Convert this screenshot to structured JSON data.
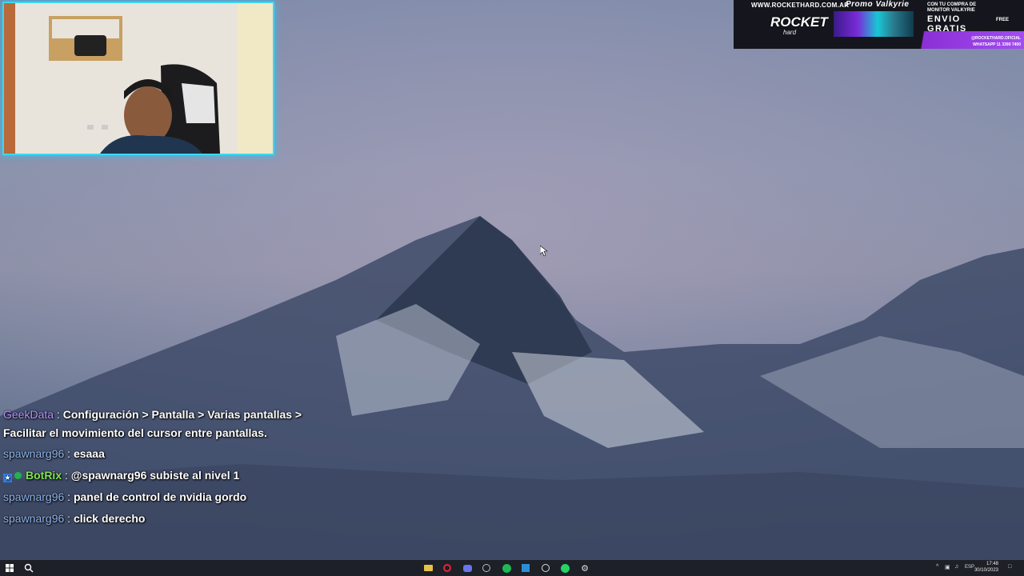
{
  "webcam": {
    "label": "streamer-webcam"
  },
  "ad": {
    "url": "WWW.ROCKETHARD.COM.AR",
    "promo_title": "Promo Valkyrie",
    "small_text": "CON TU COMPRA DE MONITOR VALKYRIE",
    "envio": "ENVIO",
    "gratis": "GRATIS",
    "logo": "ROCKET",
    "logo_sub": "hard",
    "free_badge": "FREE",
    "social_1": "@ROCKETHARD.OFICIAL",
    "social_2": "WHATSAPP 11 3390 7400"
  },
  "chat": {
    "messages": [
      {
        "user": "GeekData",
        "sep": " : ",
        "text": "Configuración > Pantalla > Varias pantallas >",
        "continuation": "Facilitar el movimiento del cursor entre pantallas."
      },
      {
        "user": "spawnarg96",
        "sep": " : ",
        "text": "esaaa"
      },
      {
        "user": "BotRix",
        "sep": " : ",
        "text": "@spawnarg96 subiste al nivel 1"
      },
      {
        "user": "spawnarg96",
        "sep": " : ",
        "text": "panel de control de nvidia gordo"
      },
      {
        "user": "spawnarg96",
        "sep": " : ",
        "text": "click derecho"
      }
    ]
  },
  "taskbar": {
    "lang": "ESP",
    "time": "17:48",
    "date": "30/10/2023",
    "apps": [
      "folder-icon",
      "opera-icon",
      "discord-icon",
      "chrome-icon",
      "spotify-icon",
      "editor-icon",
      "network-icon",
      "whatsapp-icon",
      "settings-icon"
    ]
  },
  "colors": {
    "accent_webcam": "#3ad9f0",
    "username_default": "#8fb3e8",
    "username_geek": "#b693ff",
    "username_bot": "#7fe34f"
  }
}
